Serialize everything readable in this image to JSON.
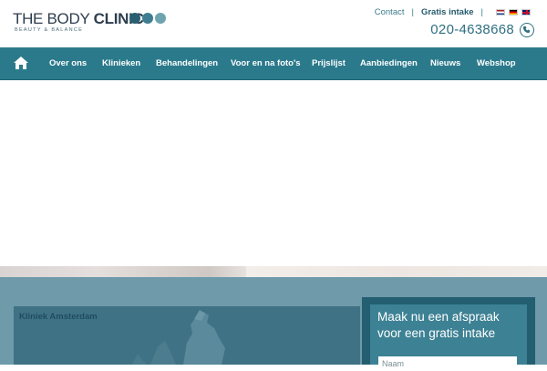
{
  "logo": {
    "the_body": "THE BODY",
    "clinic": "CLINIC",
    "tagline": "BEAUTY & BALANCE"
  },
  "toplinks": {
    "contact": "Contact",
    "separator": "|",
    "intake": "Gratis intake",
    "languages": [
      "nl-flag",
      "de-flag",
      "en-flag"
    ]
  },
  "phone": {
    "number": "020-4638668",
    "icon": "phone-icon"
  },
  "nav": {
    "home_icon": "home-icon",
    "items": [
      {
        "label": "Over ons"
      },
      {
        "label": "Klinieken"
      },
      {
        "label": "Behandelingen"
      },
      {
        "label": "Voor en na foto's"
      },
      {
        "label": "Prijslijst"
      },
      {
        "label": "Aanbiedingen"
      },
      {
        "label": "Nieuws"
      },
      {
        "label": "Webshop"
      }
    ]
  },
  "kliniek": {
    "title": "Kliniek Amsterdam"
  },
  "form": {
    "title": "Maak nu een afspraak voor een gratis intake",
    "name_placeholder": "Naam"
  },
  "colors": {
    "nav": "#2b7a8c",
    "band": "#6e9aaa",
    "form_outer": "#235e71",
    "form_inner": "#3d8194",
    "accent_text": "#2f6f82"
  }
}
